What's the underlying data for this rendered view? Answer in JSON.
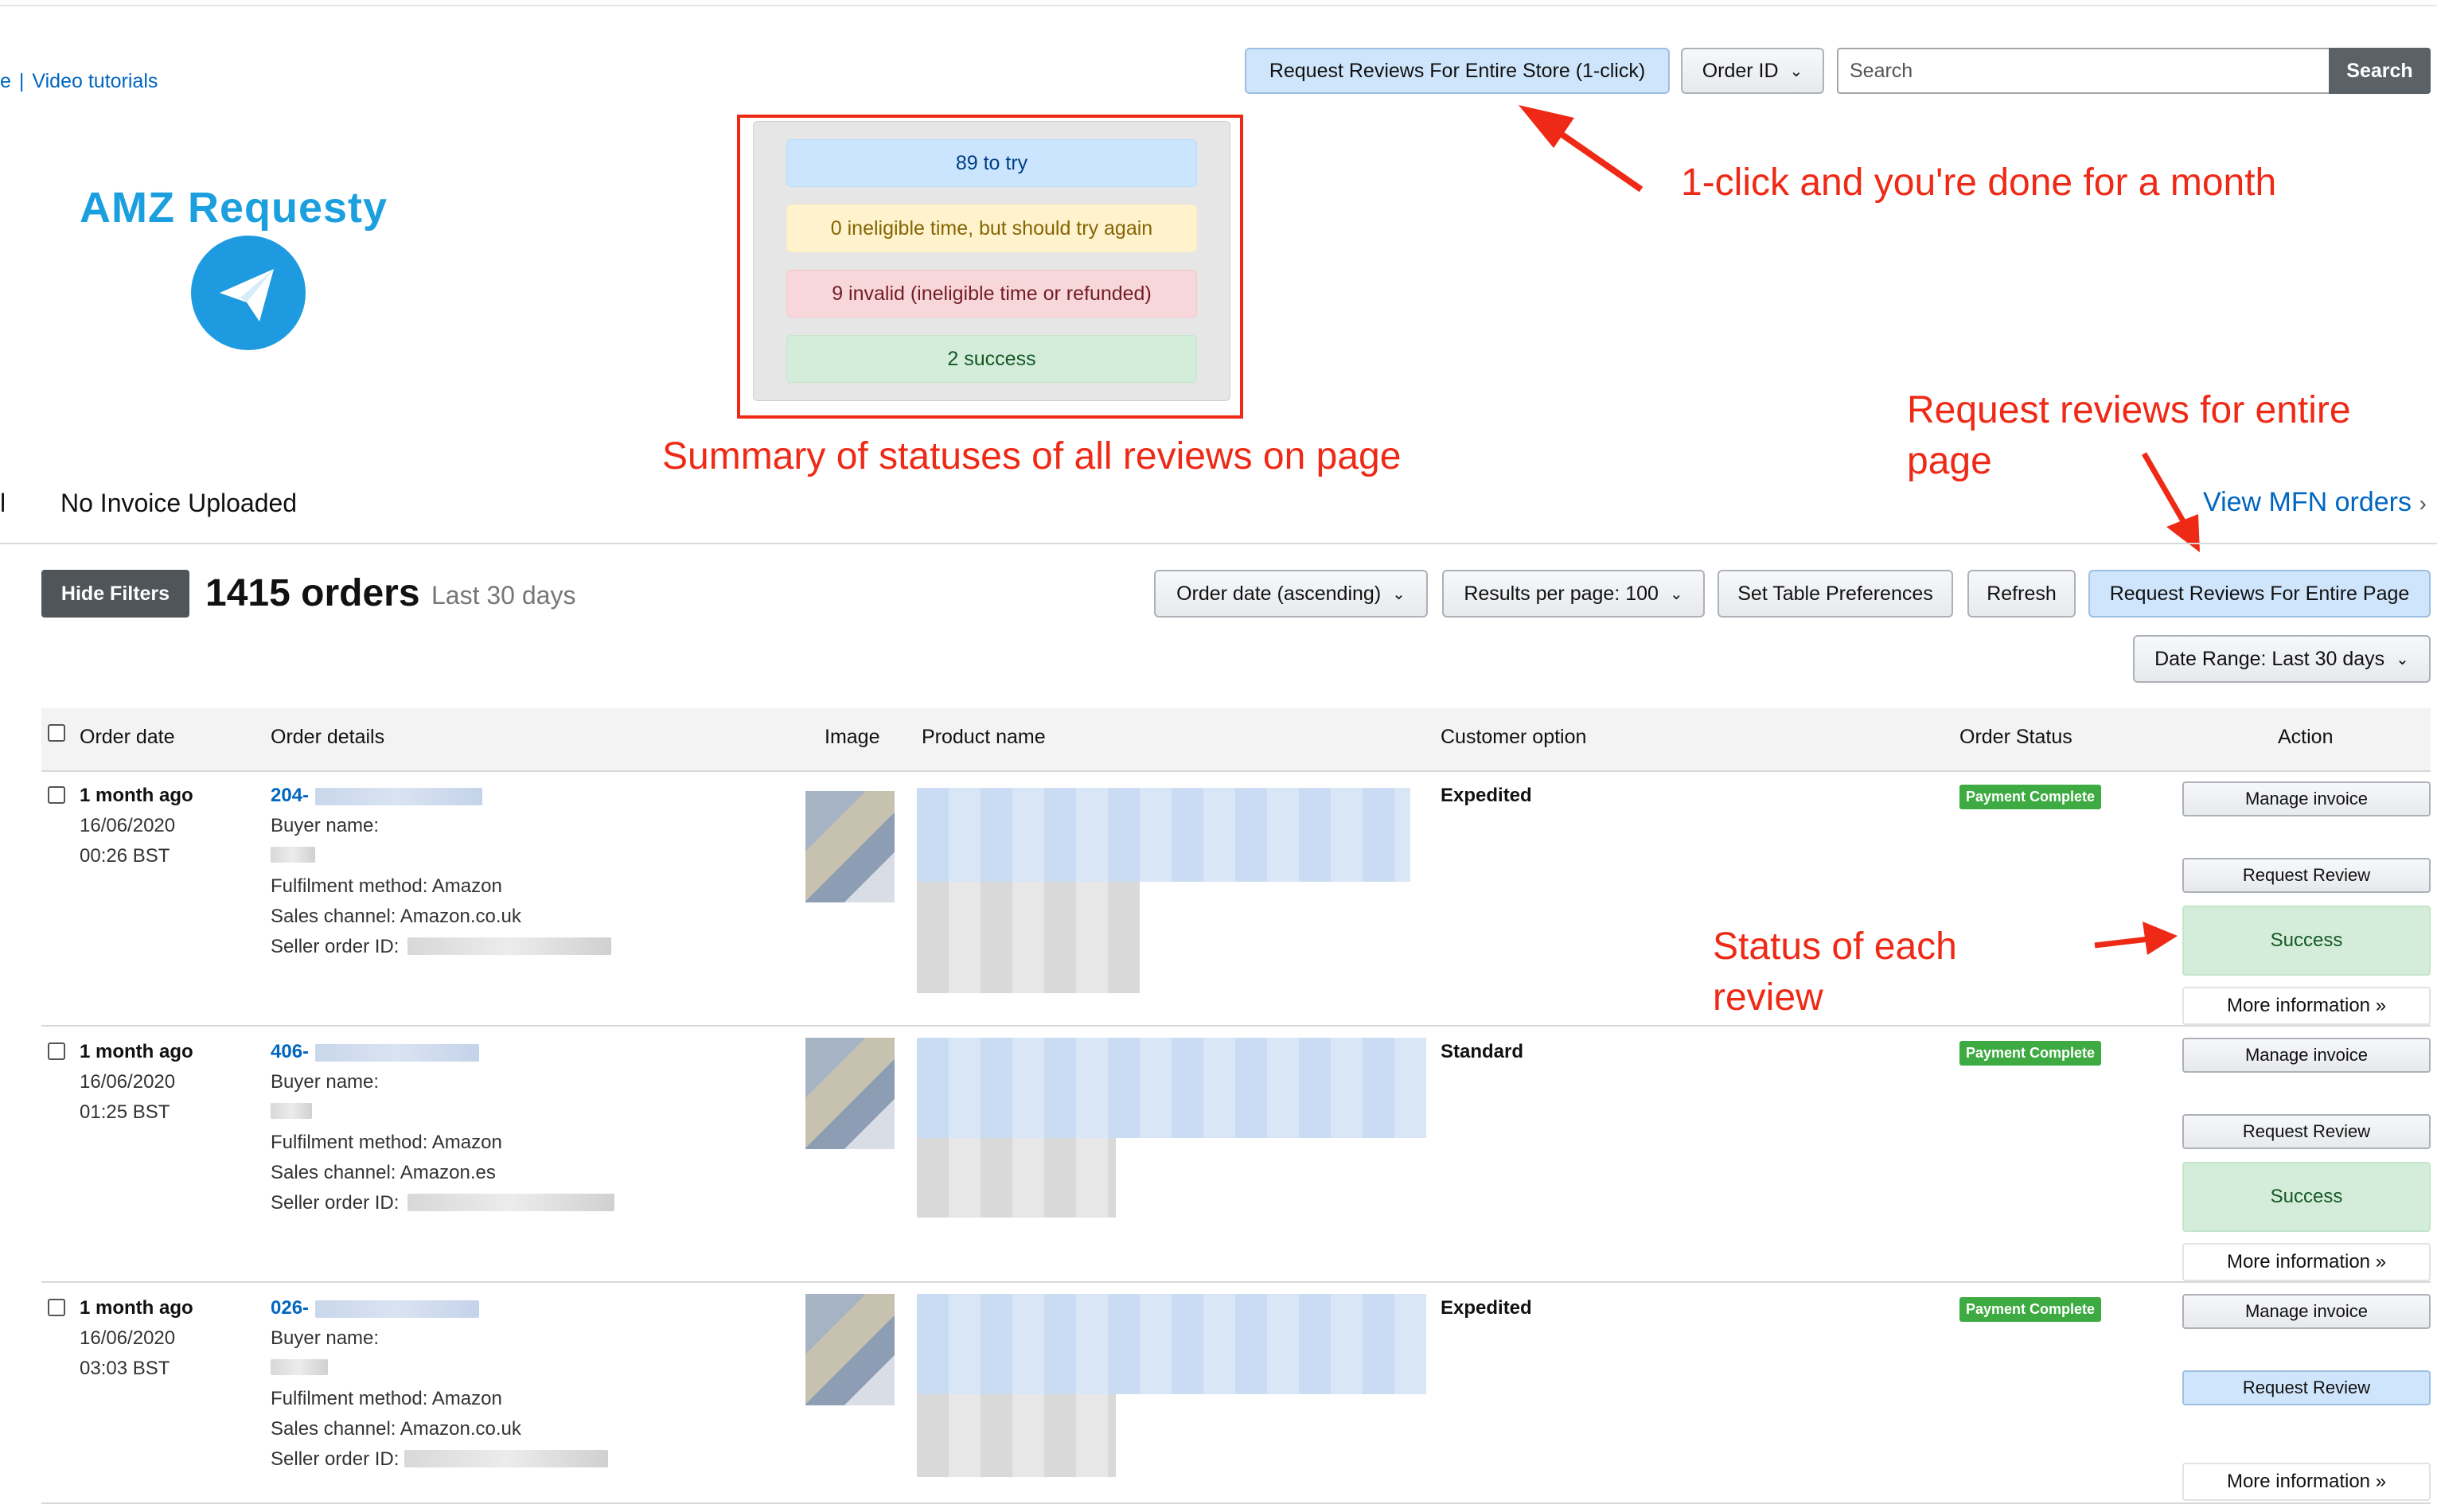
{
  "header": {
    "tutorial_link_prefix": "e",
    "tutorial_link": "Video tutorials",
    "request_store_button": "Request Reviews For Entire Store (1-click)",
    "search_field_select": "Order ID",
    "search_placeholder": "Search",
    "search_button": "Search"
  },
  "logo": {
    "text": "AMZ Requesty",
    "icon": "paper-plane-icon",
    "color": "#1b9fdf"
  },
  "summary": {
    "to_try": "89 to try",
    "ineligible_retry": "0 ineligible time, but should try again",
    "invalid": "9 invalid (ineligible time or refunded)",
    "success": "2 success"
  },
  "annotations": {
    "one_click": "1-click and you're done for a month",
    "summary": "Summary of statuses of all reviews on page",
    "entire_page": "Request reviews for entire page",
    "status_each": "Status of each review",
    "color": "#ee2a17"
  },
  "filters": {
    "left_fragment": "l",
    "invoice_filter": "No Invoice Uploaded",
    "mfn_link": "View MFN orders"
  },
  "toolbar": {
    "hide_filters": "Hide Filters",
    "orders_count": "1415 orders",
    "orders_period": "Last 30 days",
    "sort": "Order date (ascending)",
    "results_per_page": "Results per page: 100",
    "table_prefs": "Set Table Preferences",
    "refresh": "Refresh",
    "request_page": "Request Reviews For Entire Page",
    "date_range": "Date Range: Last 30 days"
  },
  "table": {
    "columns": [
      "Order date",
      "Order details",
      "Image",
      "Product name",
      "Customer option",
      "Order Status",
      "Action"
    ],
    "rows": [
      {
        "relative_date": "1 month ago",
        "date": "16/06/2020",
        "time": "00:26 BST",
        "order_id_prefix": "204-",
        "buyer_label": "Buyer name:",
        "fulfilment": "Fulfilment method: Amazon",
        "sales_channel": "Sales channel: Amazon.co.uk",
        "seller_label": "Seller order ID:",
        "customer_option": "Expedited",
        "order_status": "Payment Complete",
        "manage_invoice": "Manage invoice",
        "request_review": "Request Review",
        "review_status": "Success",
        "more_info": "More information »"
      },
      {
        "relative_date": "1 month ago",
        "date": "16/06/2020",
        "time": "01:25 BST",
        "order_id_prefix": "406-",
        "buyer_label": "Buyer name:",
        "fulfilment": "Fulfilment method: Amazon",
        "sales_channel": "Sales channel: Amazon.es",
        "seller_label": "Seller order ID:",
        "customer_option": "Standard",
        "order_status": "Payment Complete",
        "manage_invoice": "Manage invoice",
        "request_review": "Request Review",
        "review_status": "Success",
        "more_info": "More information »"
      },
      {
        "relative_date": "1 month ago",
        "date": "16/06/2020",
        "time": "03:03 BST",
        "order_id_prefix": "026-",
        "buyer_label": "Buyer name:",
        "fulfilment": "Fulfilment method: Amazon",
        "sales_channel": "Sales channel: Amazon.co.uk",
        "seller_label": "Seller order ID:",
        "customer_option": "Expedited",
        "order_status": "Payment Complete",
        "manage_invoice": "Manage invoice",
        "request_review": "Request Review",
        "more_info": "More information »"
      }
    ]
  }
}
